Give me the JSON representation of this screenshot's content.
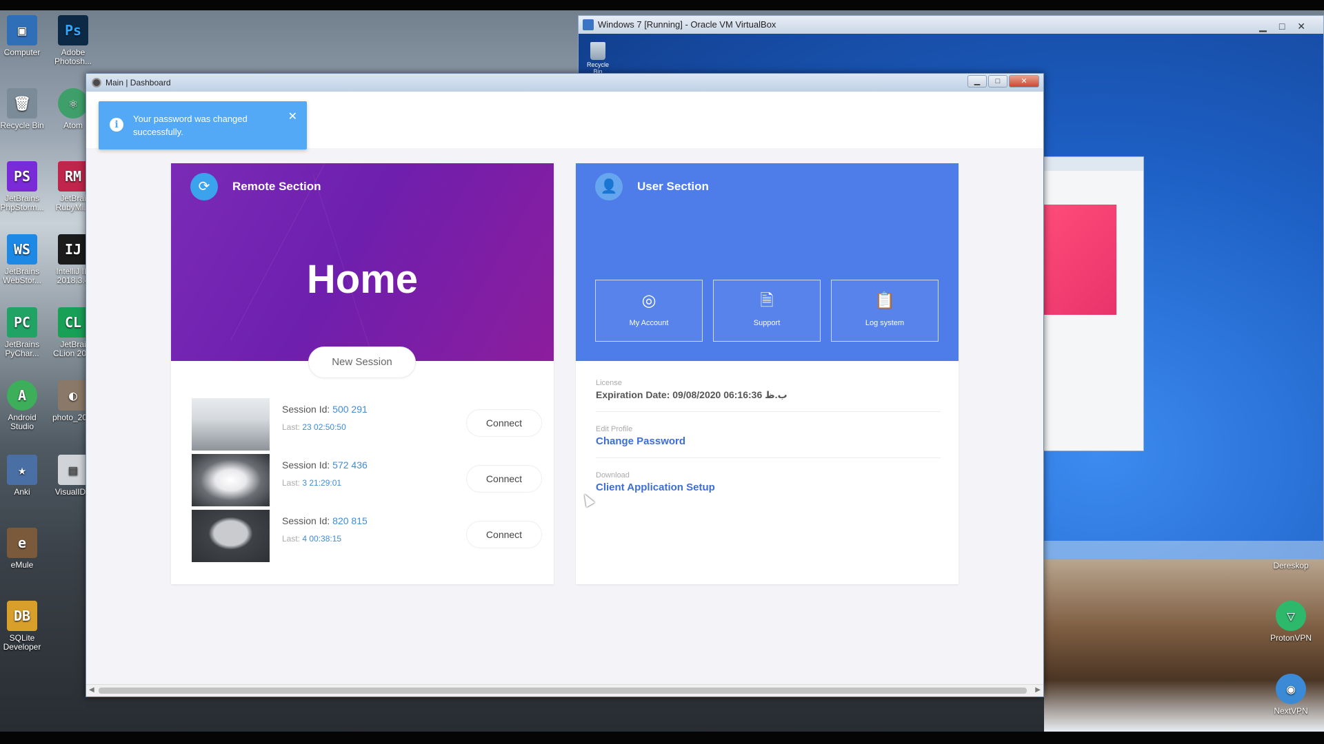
{
  "desktop": {
    "icons_left": [
      {
        "label": "Computer",
        "glyph": "▣",
        "color": "#2f6fb8"
      },
      {
        "label": "Recycle Bin",
        "glyph": "🗑",
        "color": "#7b8b98"
      },
      {
        "label": "JetBrains PhpStorm...",
        "glyph": "PS",
        "color": "#7a2bd8"
      },
      {
        "label": "JetBrains WebStor...",
        "glyph": "WS",
        "color": "#1e88e5"
      },
      {
        "label": "JetBrains PyChar...",
        "glyph": "PC",
        "color": "#21a366"
      },
      {
        "label": "Android Studio",
        "glyph": "A",
        "color": "#3dae5a"
      },
      {
        "label": "Anki",
        "glyph": "★",
        "color": "#4a6fa5"
      },
      {
        "label": "eMule",
        "glyph": "e",
        "color": "#7a5a3a"
      },
      {
        "label": "SQLite Developer",
        "glyph": "DB",
        "color": "#d8a02a"
      }
    ],
    "icons_right": [
      {
        "label": "Adobe Photosh...",
        "glyph": "Ps",
        "color": "#0c2a45"
      },
      {
        "label": "Atom",
        "glyph": "⚛",
        "color": "#3f9f6a"
      },
      {
        "label": "JetBrai RubyMi...",
        "glyph": "RM",
        "color": "#c0264b"
      },
      {
        "label": "IntelliJ ID 2018.3.4",
        "glyph": "IJ",
        "color": "#1b1b1b"
      },
      {
        "label": "JetBrai CLion 20...",
        "glyph": "CL",
        "color": "#18a057"
      },
      {
        "label": "photo_20...",
        "glyph": "◐",
        "color": "#8a7868"
      },
      {
        "label": "VisualIDE",
        "glyph": "▤",
        "color": "#d0d4d8"
      }
    ],
    "right_icons": [
      {
        "label": "Dereskop",
        "glyph": ""
      },
      {
        "label": "ProtonVPN",
        "glyph": "▽",
        "color": "#2eb86b"
      },
      {
        "label": "NextVPN",
        "glyph": "◉",
        "color": "#3a8ad6"
      }
    ]
  },
  "vbox": {
    "title": "Windows 7 [Running] - Oracle VM VirtualBox",
    "recycle_label": "Recycle Bin"
  },
  "window": {
    "title": "Main | Dashboard",
    "min": "▁",
    "max": "□",
    "close": "✕"
  },
  "toast": {
    "message": "Your password was changed successfully.",
    "icon": "i",
    "close": "✕"
  },
  "remote": {
    "section_title": "Remote Section",
    "icon": "⟳",
    "home_title": "Home",
    "new_session_label": "New Session",
    "sessions": [
      {
        "id_label": "Session Id:",
        "id": "500 291",
        "last_label": "Last:",
        "last": "23 02:50:50",
        "connect": "Connect"
      },
      {
        "id_label": "Session Id:",
        "id": "572 436",
        "last_label": "Last:",
        "last": "3 21:29:01",
        "connect": "Connect"
      },
      {
        "id_label": "Session Id:",
        "id": "820 815",
        "last_label": "Last:",
        "last": "4 00:38:15",
        "connect": "Connect"
      }
    ]
  },
  "user": {
    "section_title": "User Section",
    "icon": "👤",
    "tiles": [
      {
        "label": "My Account",
        "icon": "◎"
      },
      {
        "label": "Support",
        "icon": "🗎"
      },
      {
        "label": "Log system",
        "icon": "📋"
      }
    ],
    "license_label": "License",
    "license_value": "Expiration Date: 09/08/2020 06:16:36 ب.ظ",
    "edit_profile_label": "Edit Profile",
    "change_password": "Change Password",
    "download_label": "Download",
    "client_setup": "Client Application Setup"
  }
}
